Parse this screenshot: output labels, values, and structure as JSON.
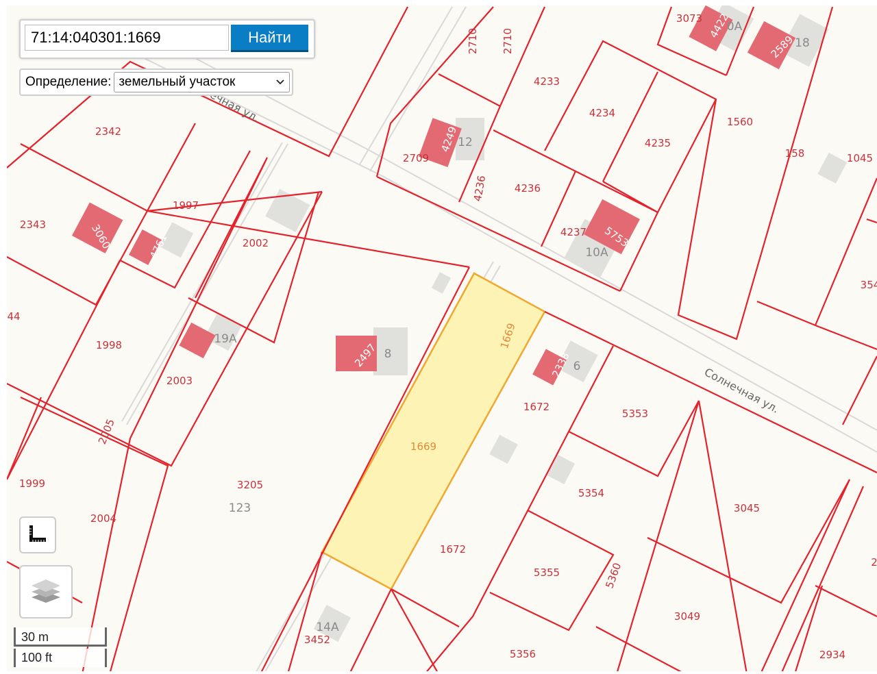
{
  "search": {
    "value": "71:14:040301:1669",
    "button_label": "Найти"
  },
  "definition": {
    "label": "Определение:",
    "selected": "земельный участок"
  },
  "scale": {
    "metric": "30 m",
    "imperial": "100 ft"
  },
  "colors": {
    "parcel_border": "#e3222c",
    "selected_fill": "#fdf3b4",
    "selected_border": "#f0a830",
    "search_button": "#0a7ec4"
  },
  "selected_parcel": "1669",
  "streets": [
    "Солнечная ул.",
    "ечная ул."
  ],
  "labels": [
    "2710",
    "2710",
    "3073",
    "4422",
    "0А",
    "2589",
    "18",
    "4233",
    "4234",
    "4235",
    "1560",
    "158",
    "1045",
    "2342",
    "4249",
    "12",
    "2709",
    "4236",
    "4236",
    "1997",
    "2343",
    "3060",
    "4761",
    "2002",
    "4237",
    "5753",
    "10А",
    "354",
    "44",
    "19А",
    "1998",
    "2497",
    "8",
    "1669",
    "2338",
    "6",
    "2003",
    "1672",
    "5353",
    "2005",
    "1669",
    "1999",
    "3205",
    "123",
    "5354",
    "3045",
    "2004",
    "1672",
    "5355",
    "5360",
    "2",
    "3049",
    "14А",
    "3452",
    "5356",
    "2934"
  ]
}
